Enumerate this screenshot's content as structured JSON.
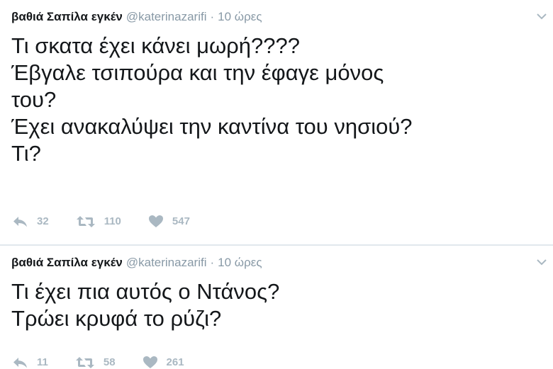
{
  "tweets": [
    {
      "author": {
        "name": "βαθιά Σαπίλα εγκέν",
        "handle": "@katerinazarifi"
      },
      "separator": "·",
      "time": "10 ώρες",
      "lines": [
        "Τι σκατα έχει κάνει μωρή????",
        "Έβγαλε τσιπούρα και την έφαγε μόνος",
        "του?",
        "Έχει ανακαλύψει την καντίνα του νησιού?",
        "Τι?"
      ],
      "replies": "32",
      "retweets": "110",
      "likes": "547"
    },
    {
      "author": {
        "name": "βαθιά Σαπίλα εγκέν",
        "handle": "@katerinazarifi"
      },
      "separator": "·",
      "time": "10 ώρες",
      "lines": [
        "Τι έχει πια αυτός ο Ντάνος?",
        "Τρώει κρυφά το ρύζι?"
      ],
      "replies": "11",
      "retweets": "58",
      "likes": "261"
    }
  ],
  "icons": {
    "reply": "reply-icon",
    "retweet": "retweet-icon",
    "like": "heart-icon",
    "more": "chevron-down-icon"
  },
  "colors": {
    "text": "#14171a",
    "meta": "#8899a6",
    "action": "#aab8c2",
    "divider": "#e1e8ed"
  }
}
